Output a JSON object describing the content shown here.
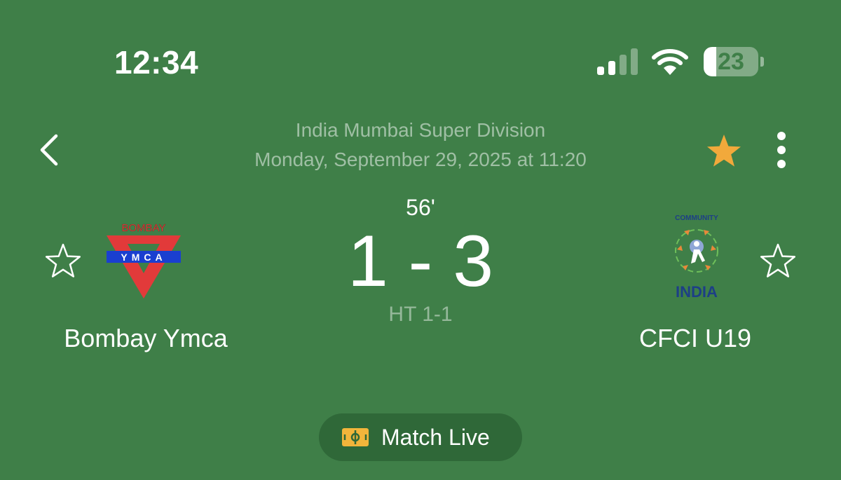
{
  "status_bar": {
    "time": "12:34",
    "battery_level": "23",
    "battery_fraction": 0.23,
    "signal_bars_active": 2,
    "signal_bars_total": 4,
    "icons": [
      "cellular-signal-icon",
      "wifi-icon",
      "battery-icon"
    ]
  },
  "header": {
    "league": "India Mumbai Super Division",
    "datetime": "Monday, September 29, 2025 at 11:20",
    "back_icon": "chevron-left-icon",
    "favorite_icon": "star-filled-icon",
    "favorite_color": "#f2a93b",
    "more_icon": "more-vertical-icon"
  },
  "match": {
    "minute": "56'",
    "score": "1 - 3",
    "home_score": 1,
    "away_score": 3,
    "halftime": "HT 1-1"
  },
  "home_team": {
    "name": "Bombay Ymca",
    "logo_text_top": "BOMBAY",
    "logo_text_band": "YMCA",
    "logo_colors": {
      "triangle": "#e23a3a",
      "band": "#1a3fd0"
    },
    "favorite_icon": "star-outline-icon"
  },
  "away_team": {
    "name": "CFCI U19",
    "logo_text_top": "COMMUNITY",
    "logo_text_bottom": "INDIA",
    "logo_colors": {
      "text": "#1d3f86",
      "accent": "#e8893a"
    },
    "favorite_icon": "star-outline-icon"
  },
  "live_button": {
    "label": "Match Live",
    "icon": "football-pitch-icon",
    "icon_color": "#f2b53b"
  },
  "colors": {
    "background": "#3f7f48",
    "pill": "#2f6838"
  }
}
